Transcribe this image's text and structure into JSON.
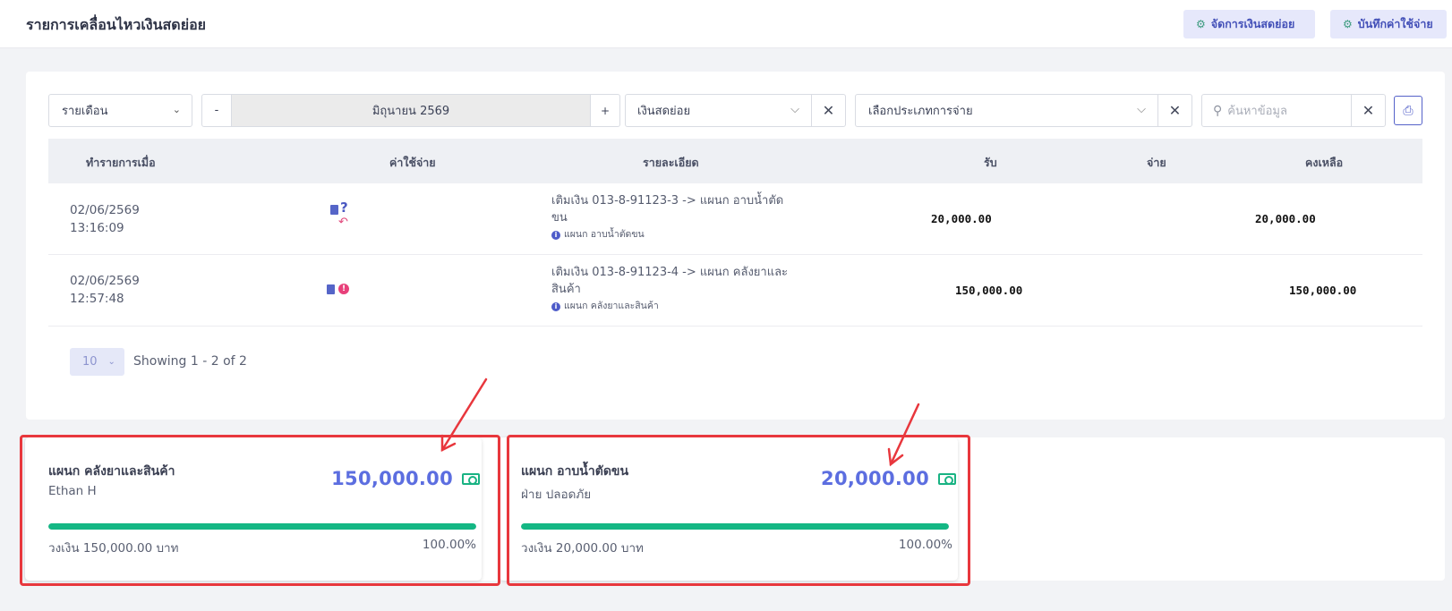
{
  "header": {
    "title": "รายการเคลื่อนไหวเงินสดย่อย",
    "btn_manage": "จัดการเงินสดย่อย",
    "btn_record": "บันทึกค่าใช้จ่าย"
  },
  "filters": {
    "period": "รายเดือน",
    "minus": "-",
    "month": "มิถุนายน 2569",
    "plus": "+",
    "fund": "เงินสดย่อย",
    "expense_type_placeholder": "เลือกประเภทการจ่าย",
    "search_placeholder": "ค้นหาข้อมูล"
  },
  "table": {
    "headers": {
      "date": "ทำรายการเมื่อ",
      "expense": "ค่าใช้จ่าย",
      "detail": "รายละเอียด",
      "receive": "รับ",
      "pay": "จ่าย",
      "balance": "คงเหลือ"
    },
    "rows": [
      {
        "date": "02/06/2569",
        "time": "13:16:09",
        "detail_line1": "เติมเงิน 013-8-91123-3 -> แผนก อาบน้ำตัด",
        "detail_line2": "ขน",
        "sub": "แผนก อาบน้ำตัดขน",
        "receive": "20,000.00",
        "pay": "",
        "balance": "20,000.00"
      },
      {
        "date": "02/06/2569",
        "time": "12:57:48",
        "detail_line1": "เติมเงิน 013-8-91123-4 -> แผนก คลังยาและ",
        "detail_line2": "สินค้า",
        "sub": "แผนก คลังยาและสินค้า",
        "receive": "150,000.00",
        "pay": "",
        "balance": "150,000.00"
      }
    ]
  },
  "pagination": {
    "page_size": "10",
    "showing": "Showing 1 - 2 of 2"
  },
  "wallets": [
    {
      "name": "แผนก คลังยาและสินค้า",
      "owner": "Ethan H",
      "amount": "150,000.00",
      "limit_text": "วงเงิน 150,000.00 บาท",
      "percent_text": "100.00%",
      "percent": 100
    },
    {
      "name": "แผนก อาบน้ำตัดขน",
      "owner": "ฝ่าย ปลอดภัย",
      "amount": "20,000.00",
      "limit_text": "วงเงิน 20,000.00 บาท",
      "percent_text": "100.00%",
      "percent": 100
    }
  ],
  "colors": {
    "accent": "#5c6ee0",
    "progress": "#14b784",
    "annotation": "#e8373d"
  }
}
